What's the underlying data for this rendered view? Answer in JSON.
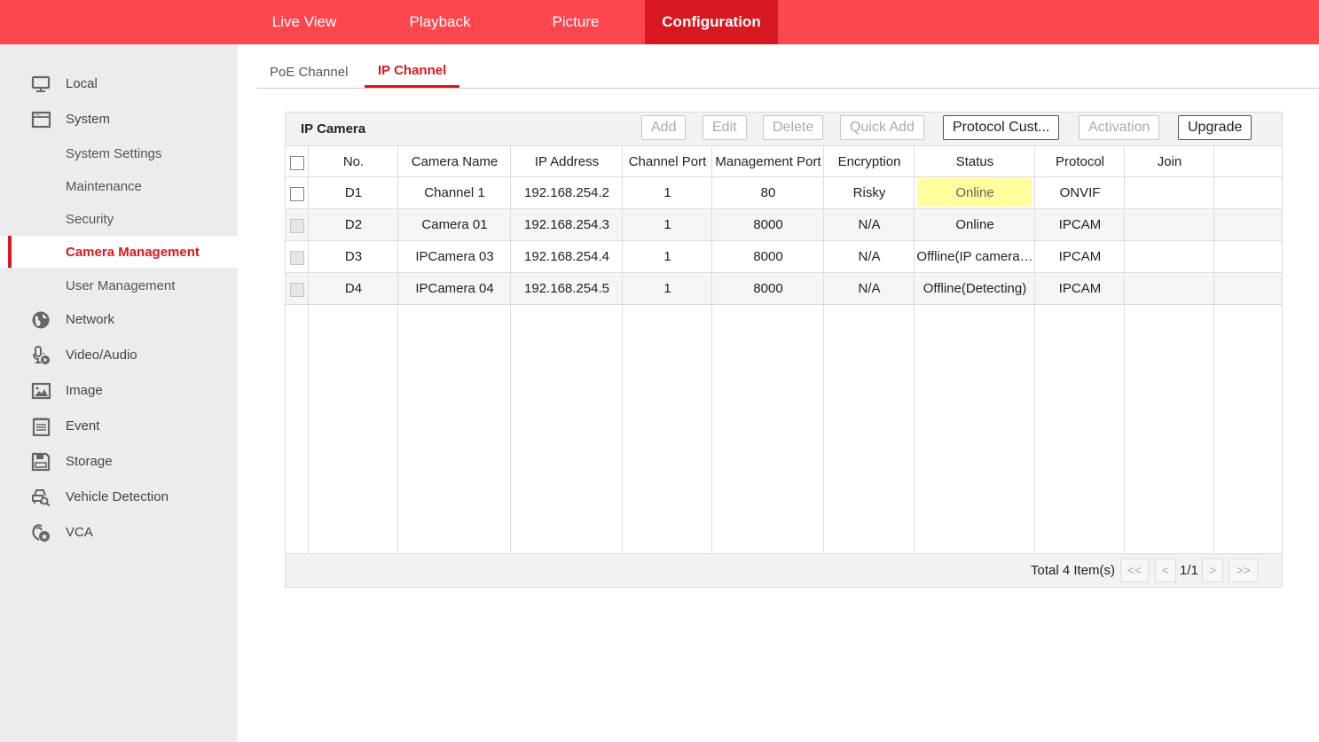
{
  "topnav": {
    "items": [
      {
        "label": "Live View",
        "active": false
      },
      {
        "label": "Playback",
        "active": false
      },
      {
        "label": "Picture",
        "active": false
      },
      {
        "label": "Configuration",
        "active": true
      }
    ]
  },
  "sidebar": {
    "items": [
      {
        "label": "Local",
        "icon": "monitor-icon"
      },
      {
        "label": "System",
        "icon": "system-window-icon"
      },
      {
        "label": "System Settings",
        "sub": true
      },
      {
        "label": "Maintenance",
        "sub": true
      },
      {
        "label": "Security",
        "sub": true
      },
      {
        "label": "Camera Management",
        "sub": true,
        "active": true
      },
      {
        "label": "User Management",
        "sub": true
      },
      {
        "label": "Network",
        "icon": "globe-icon"
      },
      {
        "label": "Video/Audio",
        "icon": "microphone-play-icon"
      },
      {
        "label": "Image",
        "icon": "image-icon"
      },
      {
        "label": "Event",
        "icon": "notepad-icon"
      },
      {
        "label": "Storage",
        "icon": "floppy-disk-icon"
      },
      {
        "label": "Vehicle Detection",
        "icon": "vehicle-search-icon"
      },
      {
        "label": "VCA",
        "icon": "vca-icon"
      }
    ]
  },
  "tabs": [
    {
      "label": "PoE Channel",
      "active": false
    },
    {
      "label": "IP Channel",
      "active": true
    }
  ],
  "panel": {
    "title": "IP Camera",
    "buttons": [
      {
        "label": "Add",
        "enabled": false
      },
      {
        "label": "Edit",
        "enabled": false
      },
      {
        "label": "Delete",
        "enabled": false
      },
      {
        "label": "Quick Add",
        "enabled": false
      },
      {
        "label": "Protocol Cust...",
        "enabled": true
      },
      {
        "label": "Activation",
        "enabled": false
      },
      {
        "label": "Upgrade",
        "enabled": true
      }
    ],
    "columns": [
      "No.",
      "Camera Name",
      "IP Address",
      "Channel Port",
      "Management Port",
      "Encryption",
      "Status",
      "Protocol",
      "Join",
      ""
    ],
    "rows": [
      {
        "no": "D1",
        "name": "Channel 1",
        "ip": "192.168.254.2",
        "channel_port": "1",
        "mgmt_port": "80",
        "encryption": "Risky",
        "status": "Online",
        "protocol": "ONVIF",
        "join": "",
        "highlight": true,
        "checkbox_enabled": true
      },
      {
        "no": "D2",
        "name": "Camera 01",
        "ip": "192.168.254.3",
        "channel_port": "1",
        "mgmt_port": "8000",
        "encryption": "N/A",
        "status": "Online",
        "protocol": "IPCAM",
        "join": "",
        "highlight": false,
        "checkbox_enabled": false
      },
      {
        "no": "D3",
        "name": "IPCamera 03",
        "ip": "192.168.254.4",
        "channel_port": "1",
        "mgmt_port": "8000",
        "encryption": "N/A",
        "status": "Offline(IP camera…",
        "protocol": "IPCAM",
        "join": "",
        "highlight": false,
        "checkbox_enabled": false
      },
      {
        "no": "D4",
        "name": "IPCamera 04",
        "ip": "192.168.254.5",
        "channel_port": "1",
        "mgmt_port": "8000",
        "encryption": "N/A",
        "status": "Offline(Detecting)",
        "protocol": "IPCAM",
        "join": "",
        "highlight": false,
        "checkbox_enabled": false
      }
    ],
    "footer": {
      "total": "Total 4 Item(s)",
      "first": "<<",
      "prev": "<",
      "page": "1/1",
      "next": ">",
      "last": ">>"
    }
  },
  "colors": {
    "brand": "#fd464e",
    "brand_active": "#d71820",
    "highlight": "#ffff9e"
  }
}
